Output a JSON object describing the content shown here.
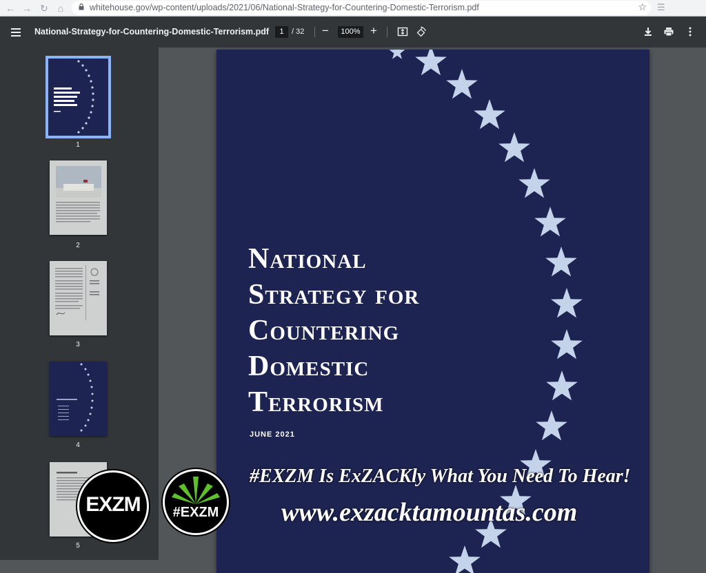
{
  "browser": {
    "url": "whitehouse.gov/wp-content/uploads/2021/06/National-Strategy-for-Countering-Domestic-Terrorism.pdf"
  },
  "toolbar": {
    "title": "National-Strategy-for-Countering-Domestic-Terrorism.pdf",
    "page_current": "1",
    "page_total": "/ 32",
    "zoom": "100%"
  },
  "thumbnails": [
    {
      "num": "1"
    },
    {
      "num": "2"
    },
    {
      "num": "3"
    },
    {
      "num": "4"
    },
    {
      "num": "5"
    }
  ],
  "page": {
    "title_lines": [
      "National",
      "Strategy for",
      "Countering",
      "Domestic",
      "Terrorism"
    ],
    "date": "JUNE 2021"
  },
  "watermark": {
    "line1": "#EXZM Is ExZACKly What You Need To Hear!",
    "line2": "www.exzacktamountas.com",
    "logo1": "EXZM",
    "logo2": "#EXZM"
  },
  "colors": {
    "cover_navy": "#1e2452",
    "star_color": "#c5d3ea",
    "accent": "#8ab4f8"
  }
}
